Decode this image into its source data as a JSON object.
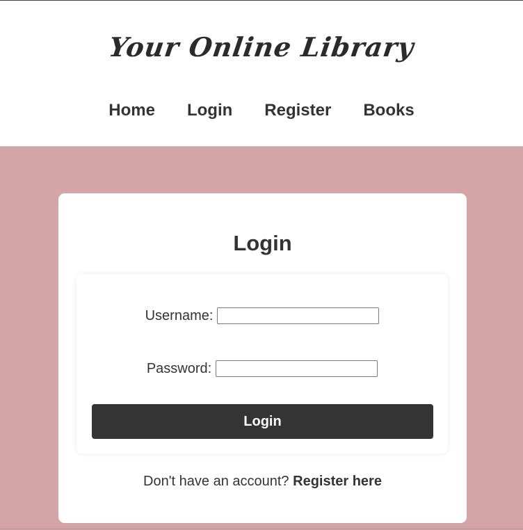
{
  "header": {
    "site_title": "Your Online Library",
    "nav": [
      {
        "label": "Home"
      },
      {
        "label": "Login"
      },
      {
        "label": "Register"
      },
      {
        "label": "Books"
      }
    ]
  },
  "login_card": {
    "title": "Login",
    "username_label": "Username:",
    "username_value": "",
    "password_label": "Password:",
    "password_value": "",
    "submit_label": "Login",
    "register_prompt": "Don't have an account?",
    "register_link": "Register here"
  },
  "colors": {
    "page_background": "#d4a5a7",
    "card_background": "#ffffff",
    "button_background": "#353434",
    "text": "#333333"
  }
}
